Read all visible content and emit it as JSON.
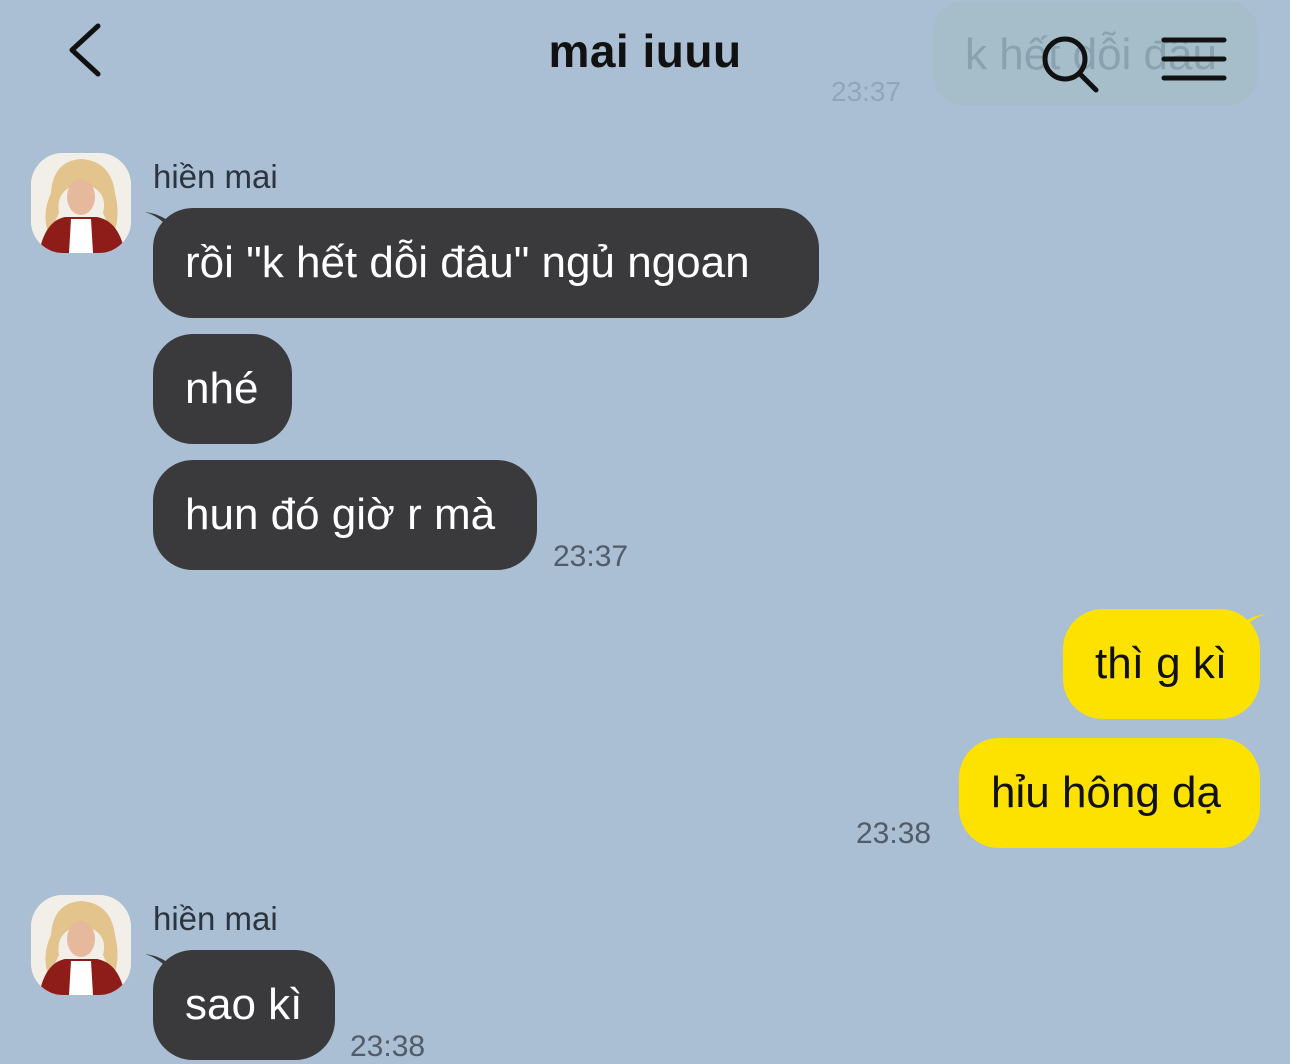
{
  "header": {
    "title": "mai iuuu",
    "back_icon": "chevron-left-icon",
    "search_icon": "search-icon",
    "menu_icon": "hamburger-menu-icon",
    "ghost_preview_text": "k hết dỗi đâu",
    "ghost_preview_time": "23:37"
  },
  "colors": {
    "background": "#aabfd3",
    "incoming_bubble": "#3a3a3c",
    "outgoing_bubble": "#fde200"
  },
  "messages": {
    "group1": {
      "sender": "hiền mai",
      "bubbles": [
        "rồi \"k hết dỗi đâu\" ngủ ngoan",
        "nhé",
        "hun đó giờ r mà"
      ],
      "time": "23:37"
    },
    "group2": {
      "bubbles": [
        "thì g kì",
        "hỉu hông dạ"
      ],
      "time": "23:38"
    },
    "group3": {
      "sender": "hiền mai",
      "bubbles": [
        "sao kì"
      ],
      "time": "23:38"
    }
  }
}
